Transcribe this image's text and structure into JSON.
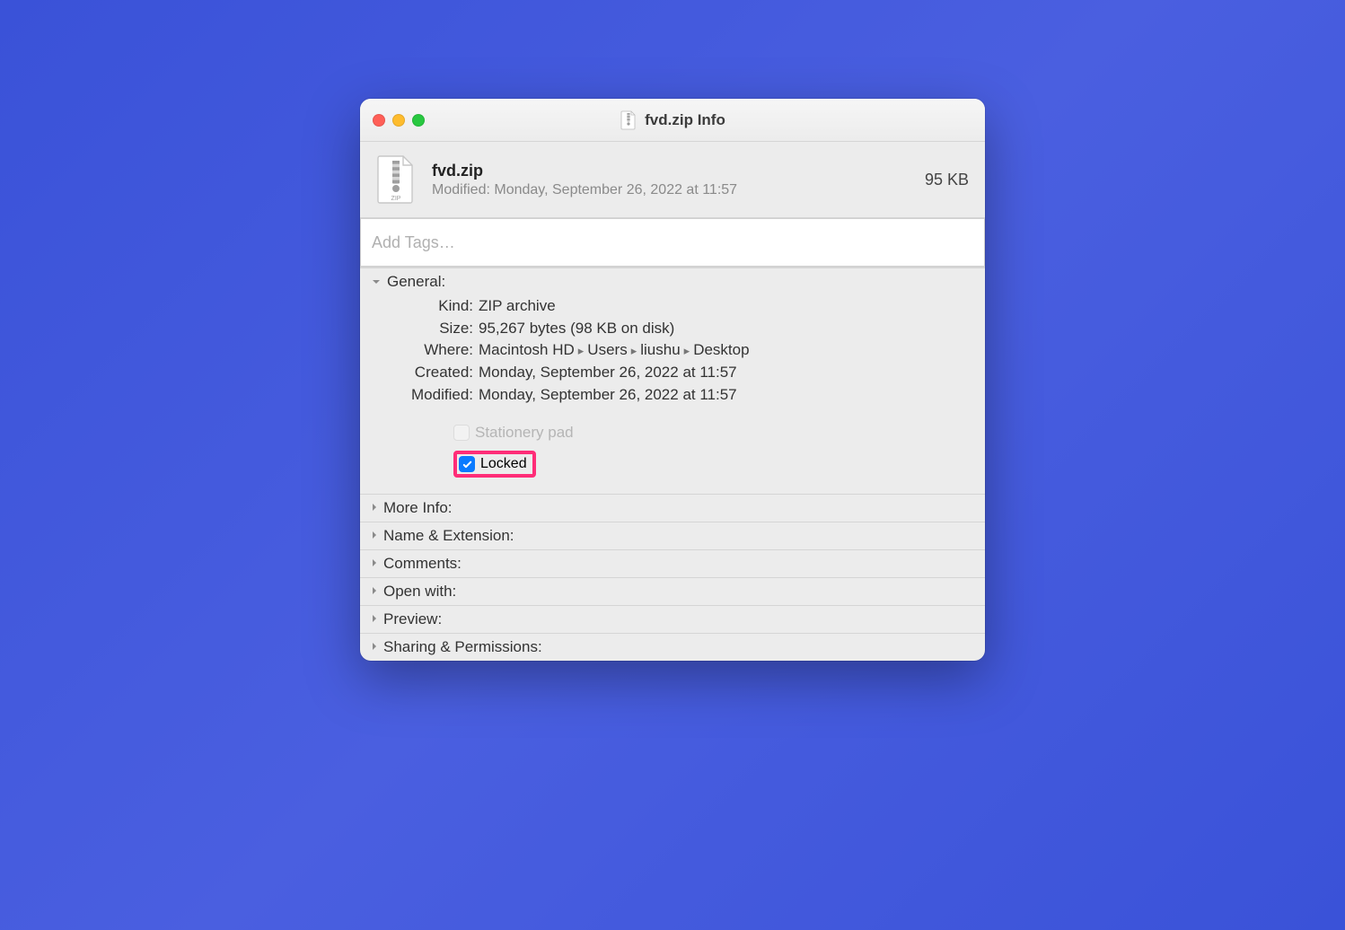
{
  "window": {
    "title": "fvd.zip Info"
  },
  "header": {
    "filename": "fvd.zip",
    "modified_label": "Modified: Monday, September 26, 2022 at 11:57",
    "size": "95 KB"
  },
  "tags": {
    "placeholder": "Add Tags…"
  },
  "general": {
    "title": "General:",
    "kind_label": "Kind:",
    "kind_value": "ZIP archive",
    "size_label": "Size:",
    "size_value": "95,267 bytes (98 KB on disk)",
    "where_label": "Where:",
    "where_parts": [
      "Macintosh HD",
      "Users",
      "liushu",
      "Desktop"
    ],
    "created_label": "Created:",
    "created_value": "Monday, September 26, 2022 at 11:57",
    "modified_label": "Modified:",
    "modified_value": "Monday, September 26, 2022 at 11:57",
    "stationery_label": "Stationery pad",
    "stationery_checked": false,
    "stationery_enabled": false,
    "locked_label": "Locked",
    "locked_checked": true
  },
  "sections": {
    "more_info": "More Info:",
    "name_ext": "Name & Extension:",
    "comments": "Comments:",
    "open_with": "Open with:",
    "preview": "Preview:",
    "sharing": "Sharing & Permissions:"
  }
}
